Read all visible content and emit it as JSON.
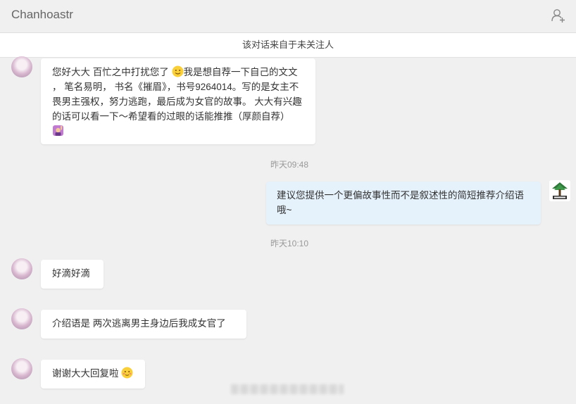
{
  "header": {
    "title": "Chanhoastr"
  },
  "notice": "该对话来自于未关注人",
  "messages": [
    {
      "text_a": "您好大大 百忙之中打扰您了",
      "text_b": "我是想自荐一下自己的文文 ， 笔名易明， 书名《摧眉》，书号9264014。写的是女主不畏男主强权，努力逃跑，最后成为女官的故事。 大大有兴趣的话可以看一下～希望看的过眼的话能推推（厚颜自荐）"
    },
    {
      "time": "昨天09:48"
    },
    {
      "text": "建议您提供一个更偏故事性而不是叙述性的简短推荐介绍语哦~"
    },
    {
      "time": "昨天10:10"
    },
    {
      "text": "好滴好滴"
    },
    {
      "text": "介绍语是  两次逃离男主身边后我成女官了"
    },
    {
      "text": "谢谢大大回复啦"
    }
  ]
}
